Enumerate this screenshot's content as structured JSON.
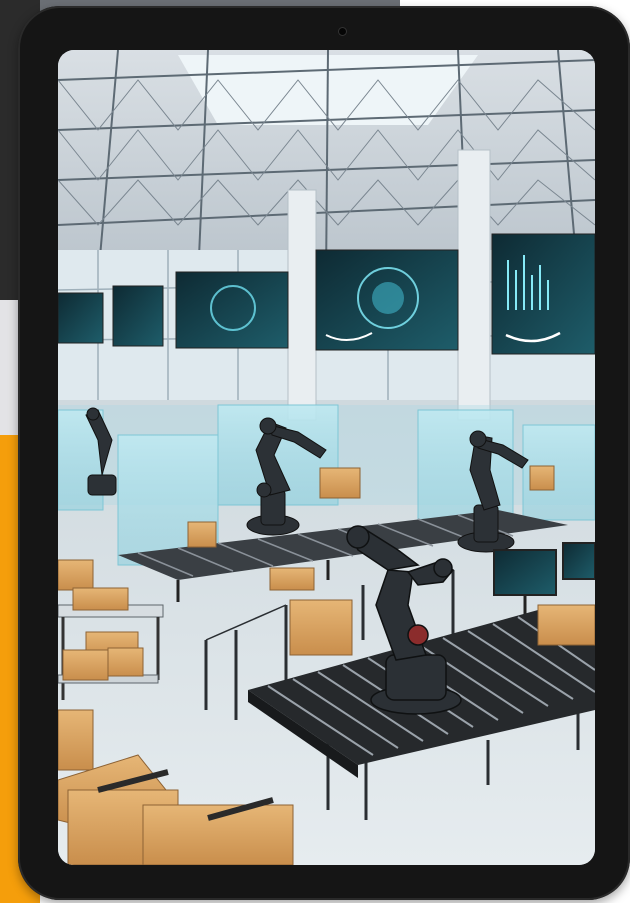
{
  "scene": {
    "description_icons": [
      "tablet-frame",
      "robotic-arm",
      "conveyor-belt",
      "cardboard-box",
      "data-display-screen"
    ],
    "colors": {
      "background_orange": "#f59e0b",
      "tablet_bezel": "#151515",
      "screen_glow": "#5fd3e6",
      "box_brown": "#d8a15e"
    }
  }
}
